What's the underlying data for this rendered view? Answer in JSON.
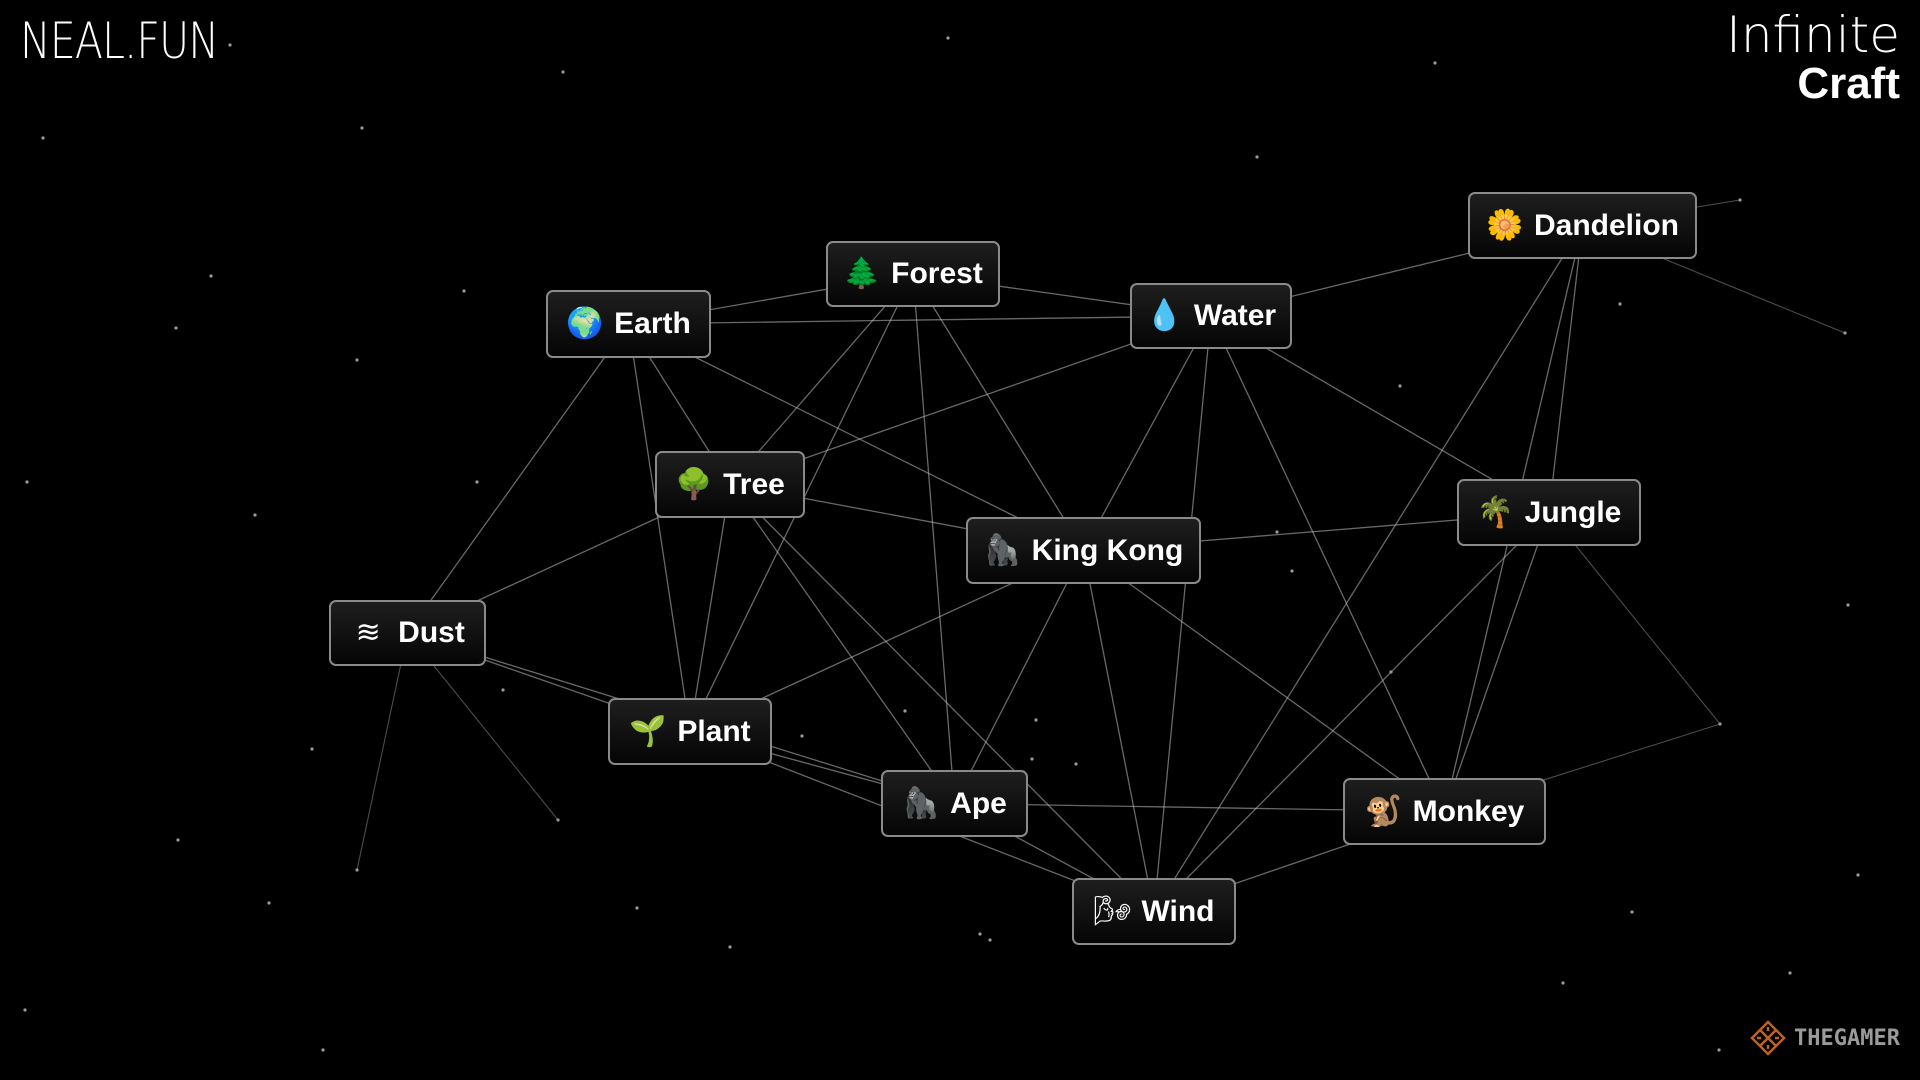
{
  "header": {
    "site_logo": "NEAL.FUN",
    "app_title_line1": "Infinite",
    "app_title_line2": "Craft"
  },
  "colors": {
    "background": "#000000",
    "node_border": "#8a8a8a",
    "edge": "#bdbdbd",
    "watermark_orange": "#c0621f",
    "watermark_text": "#9a9a9a"
  },
  "elements": [
    {
      "id": "earth",
      "label": "Earth",
      "icon": "earth-globe-icon",
      "emoji": "🌍"
    },
    {
      "id": "forest",
      "label": "Forest",
      "icon": "evergreen-tree-icon",
      "emoji": "🌲"
    },
    {
      "id": "water",
      "label": "Water",
      "icon": "water-droplet-icon",
      "emoji": "💧"
    },
    {
      "id": "dandelion",
      "label": "Dandelion",
      "icon": "flower-icon",
      "emoji": "🌼"
    },
    {
      "id": "tree",
      "label": "Tree",
      "icon": "deciduous-tree-icon",
      "emoji": "🌳"
    },
    {
      "id": "kingkong",
      "label": "King Kong",
      "icon": "gorilla-icon",
      "emoji": "🦍"
    },
    {
      "id": "jungle",
      "label": "Jungle",
      "icon": "palm-tree-icon",
      "emoji": "🌴"
    },
    {
      "id": "dust",
      "label": "Dust",
      "icon": "dash-wind-waves-icon",
      "emoji": "≋"
    },
    {
      "id": "plant",
      "label": "Plant",
      "icon": "seedling-icon",
      "emoji": "🌱"
    },
    {
      "id": "ape",
      "label": "Ape",
      "icon": "gorilla-icon",
      "emoji": "🦍"
    },
    {
      "id": "monkey",
      "label": "Monkey",
      "icon": "monkey-icon",
      "emoji": "🐒"
    },
    {
      "id": "wind",
      "label": "Wind",
      "icon": "wind-face-icon",
      "emoji": "🌬"
    }
  ],
  "connections": [
    [
      "earth",
      "forest"
    ],
    [
      "earth",
      "water"
    ],
    [
      "earth",
      "tree"
    ],
    [
      "earth",
      "plant"
    ],
    [
      "earth",
      "dust"
    ],
    [
      "earth",
      "kingkong"
    ],
    [
      "forest",
      "water"
    ],
    [
      "forest",
      "tree"
    ],
    [
      "forest",
      "kingkong"
    ],
    [
      "forest",
      "ape"
    ],
    [
      "forest",
      "plant"
    ],
    [
      "water",
      "dandelion"
    ],
    [
      "water",
      "kingkong"
    ],
    [
      "water",
      "jungle"
    ],
    [
      "water",
      "monkey"
    ],
    [
      "water",
      "wind"
    ],
    [
      "water",
      "tree"
    ],
    [
      "dandelion",
      "jungle"
    ],
    [
      "dandelion",
      "monkey"
    ],
    [
      "dandelion",
      "wind"
    ],
    [
      "tree",
      "dust"
    ],
    [
      "tree",
      "plant"
    ],
    [
      "tree",
      "kingkong"
    ],
    [
      "tree",
      "ape"
    ],
    [
      "tree",
      "wind"
    ],
    [
      "kingkong",
      "jungle"
    ],
    [
      "kingkong",
      "ape"
    ],
    [
      "kingkong",
      "wind"
    ],
    [
      "kingkong",
      "monkey"
    ],
    [
      "kingkong",
      "plant"
    ],
    [
      "jungle",
      "monkey"
    ],
    [
      "jungle",
      "wind"
    ],
    [
      "dust",
      "plant"
    ],
    [
      "dust",
      "ape"
    ],
    [
      "plant",
      "ape"
    ],
    [
      "plant",
      "wind"
    ],
    [
      "ape",
      "wind"
    ],
    [
      "ape",
      "monkey"
    ],
    [
      "monkey",
      "wind"
    ]
  ],
  "watermark": {
    "text": "THEGAMER"
  }
}
